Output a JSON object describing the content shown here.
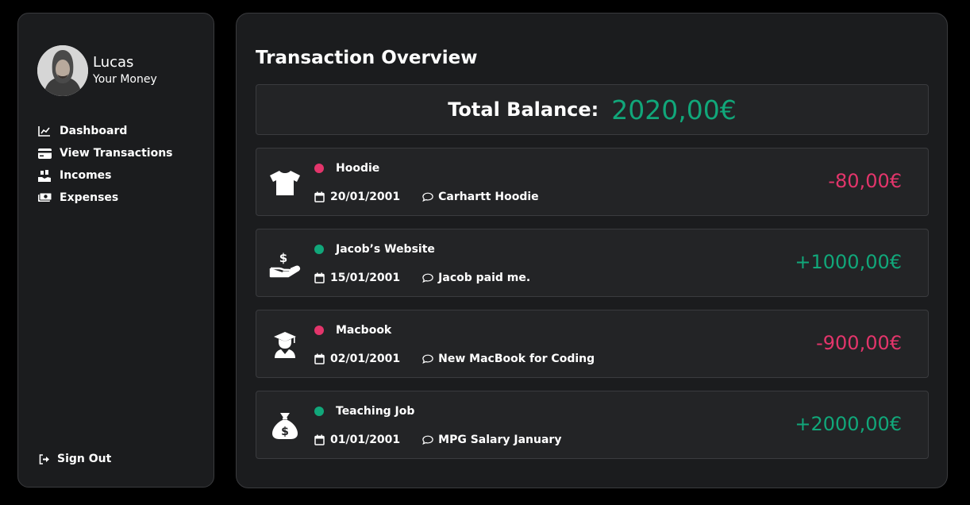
{
  "profile": {
    "name": "Lucas",
    "subtitle": "Your Money"
  },
  "nav": {
    "items": [
      {
        "label": "Dashboard",
        "icon": "chart-line-icon"
      },
      {
        "label": "View Transactions",
        "icon": "credit-card-icon"
      },
      {
        "label": "Incomes",
        "icon": "hand-holding-dollar-icon"
      },
      {
        "label": "Expenses",
        "icon": "money-bill-icon"
      }
    ],
    "signout_label": "Sign Out"
  },
  "main": {
    "title": "Transaction Overview",
    "balance_label": "Total Balance:",
    "balance_value": "2020,00€"
  },
  "transactions": [
    {
      "title": "Hoodie",
      "date": "20/01/2001",
      "note": "Carhartt Hoodie",
      "amount": "-80,00€",
      "type": "expense",
      "icon": "shirt-icon"
    },
    {
      "title": "Jacob’s Website",
      "date": "15/01/2001",
      "note": "Jacob paid me.",
      "amount": "+1000,00€",
      "type": "income",
      "icon": "hand-holding-dollar-icon"
    },
    {
      "title": "Macbook",
      "date": "02/01/2001",
      "note": "New MacBook for Coding",
      "amount": "-900,00€",
      "type": "expense",
      "icon": "graduate-icon"
    },
    {
      "title": "Teaching Job",
      "date": "01/01/2001",
      "note": "MPG Salary January",
      "amount": "+2000,00€",
      "type": "income",
      "icon": "money-bag-icon"
    }
  ],
  "colors": {
    "income": "#11a77a",
    "expense": "#e3356b",
    "panel": "#1b1c1e",
    "card": "#232426",
    "border": "#3a3b3e"
  }
}
